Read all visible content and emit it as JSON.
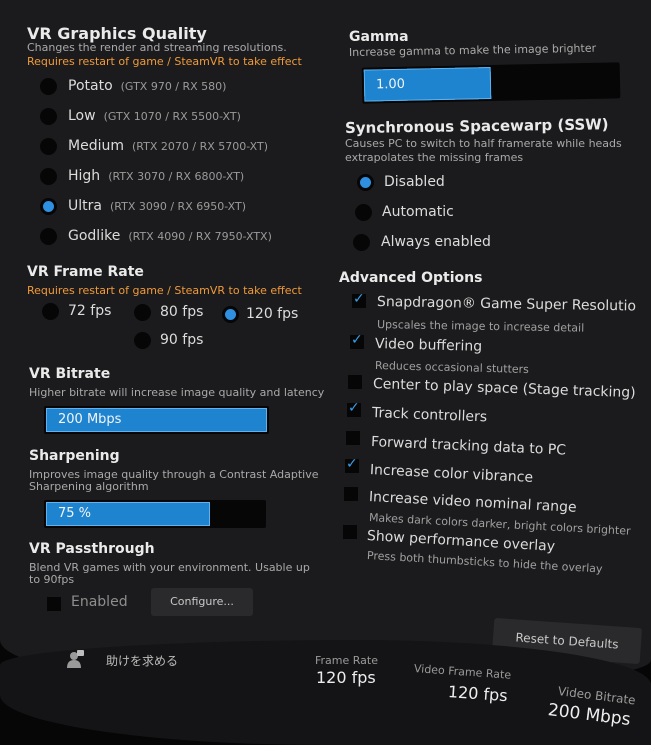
{
  "graphics": {
    "title": "VR Graphics Quality",
    "desc": "Changes the render and streaming resolutions.",
    "warning": "Requires restart of game / SteamVR to take effect",
    "options": [
      {
        "label": "Potato",
        "hint": "(GTX 970 / RX 580)"
      },
      {
        "label": "Low",
        "hint": "(GTX 1070 / RX 5500-XT)"
      },
      {
        "label": "Medium",
        "hint": "(RTX 2070 / RX 5700-XT)"
      },
      {
        "label": "High",
        "hint": "(RTX 3070 / RX 6800-XT)"
      },
      {
        "label": "Ultra",
        "hint": "(RTX 3090 / RX 6950-XT)"
      },
      {
        "label": "Godlike",
        "hint": "(RTX 4090 / RX 7950-XTX)"
      }
    ],
    "selected": "Ultra"
  },
  "framerate": {
    "title": "VR Frame Rate",
    "warning": "Requires restart of game / SteamVR to take effect",
    "options": [
      "72 fps",
      "80 fps",
      "120 fps",
      "90 fps"
    ],
    "selected": "120 fps"
  },
  "bitrate": {
    "title": "VR Bitrate",
    "desc": "Higher bitrate will increase image quality and latency",
    "value": "200 Mbps",
    "fill": 1.0
  },
  "sharpening": {
    "title": "Sharpening",
    "desc1": "Improves image quality through a Contrast Adaptive",
    "desc2": "Sharpening algorithm",
    "value": "75 %",
    "fill": 0.75
  },
  "passthrough": {
    "title": "VR Passthrough",
    "desc1": "Blend VR games with your environment. Usable up",
    "desc2": "to 90fps",
    "enabled_label": "Enabled",
    "configure_label": "Configure..."
  },
  "gamma": {
    "title": "Gamma",
    "desc": "Increase gamma to make the image brighter",
    "value": "1.00",
    "fill": 0.5
  },
  "ssw": {
    "title": "Synchronous Spacewarp (SSW)",
    "desc1": "Causes PC to switch to half framerate while heads",
    "desc2": "extrapolates the missing frames",
    "options": [
      "Disabled",
      "Automatic",
      "Always enabled"
    ],
    "selected": "Disabled"
  },
  "advanced": {
    "title": "Advanced Options",
    "options": [
      {
        "label": "Snapdragon® Game Super Resolutio",
        "desc": "Upscales the image to increase detail",
        "checked": true
      },
      {
        "label": "Video buffering",
        "desc": "Reduces occasional stutters",
        "checked": true
      },
      {
        "label": "Center to play space (Stage tracking)",
        "desc": "",
        "checked": false
      },
      {
        "label": "Track controllers",
        "desc": "",
        "checked": true
      },
      {
        "label": "Forward tracking data to PC",
        "desc": "",
        "checked": false
      },
      {
        "label": "Increase color vibrance",
        "desc": "",
        "checked": true
      },
      {
        "label": "Increase video nominal range",
        "desc": "Makes dark colors darker, bright colors brighter",
        "checked": false
      },
      {
        "label": "Show performance overlay",
        "desc": "Press both thumbsticks to hide the overlay",
        "checked": false
      }
    ]
  },
  "reset_label": "Reset to Defaults",
  "footer": {
    "help_label": "助けを求める",
    "stats": [
      {
        "label": "Frame Rate",
        "value": "120 fps"
      },
      {
        "label": "Video Frame Rate",
        "value": "120 fps"
      },
      {
        "label": "Video Bitrate",
        "value": "200 Mbps"
      }
    ]
  },
  "colors": {
    "accent": "#1e84cf",
    "warning": "#f19a38",
    "panel": "#1b1b1d"
  }
}
